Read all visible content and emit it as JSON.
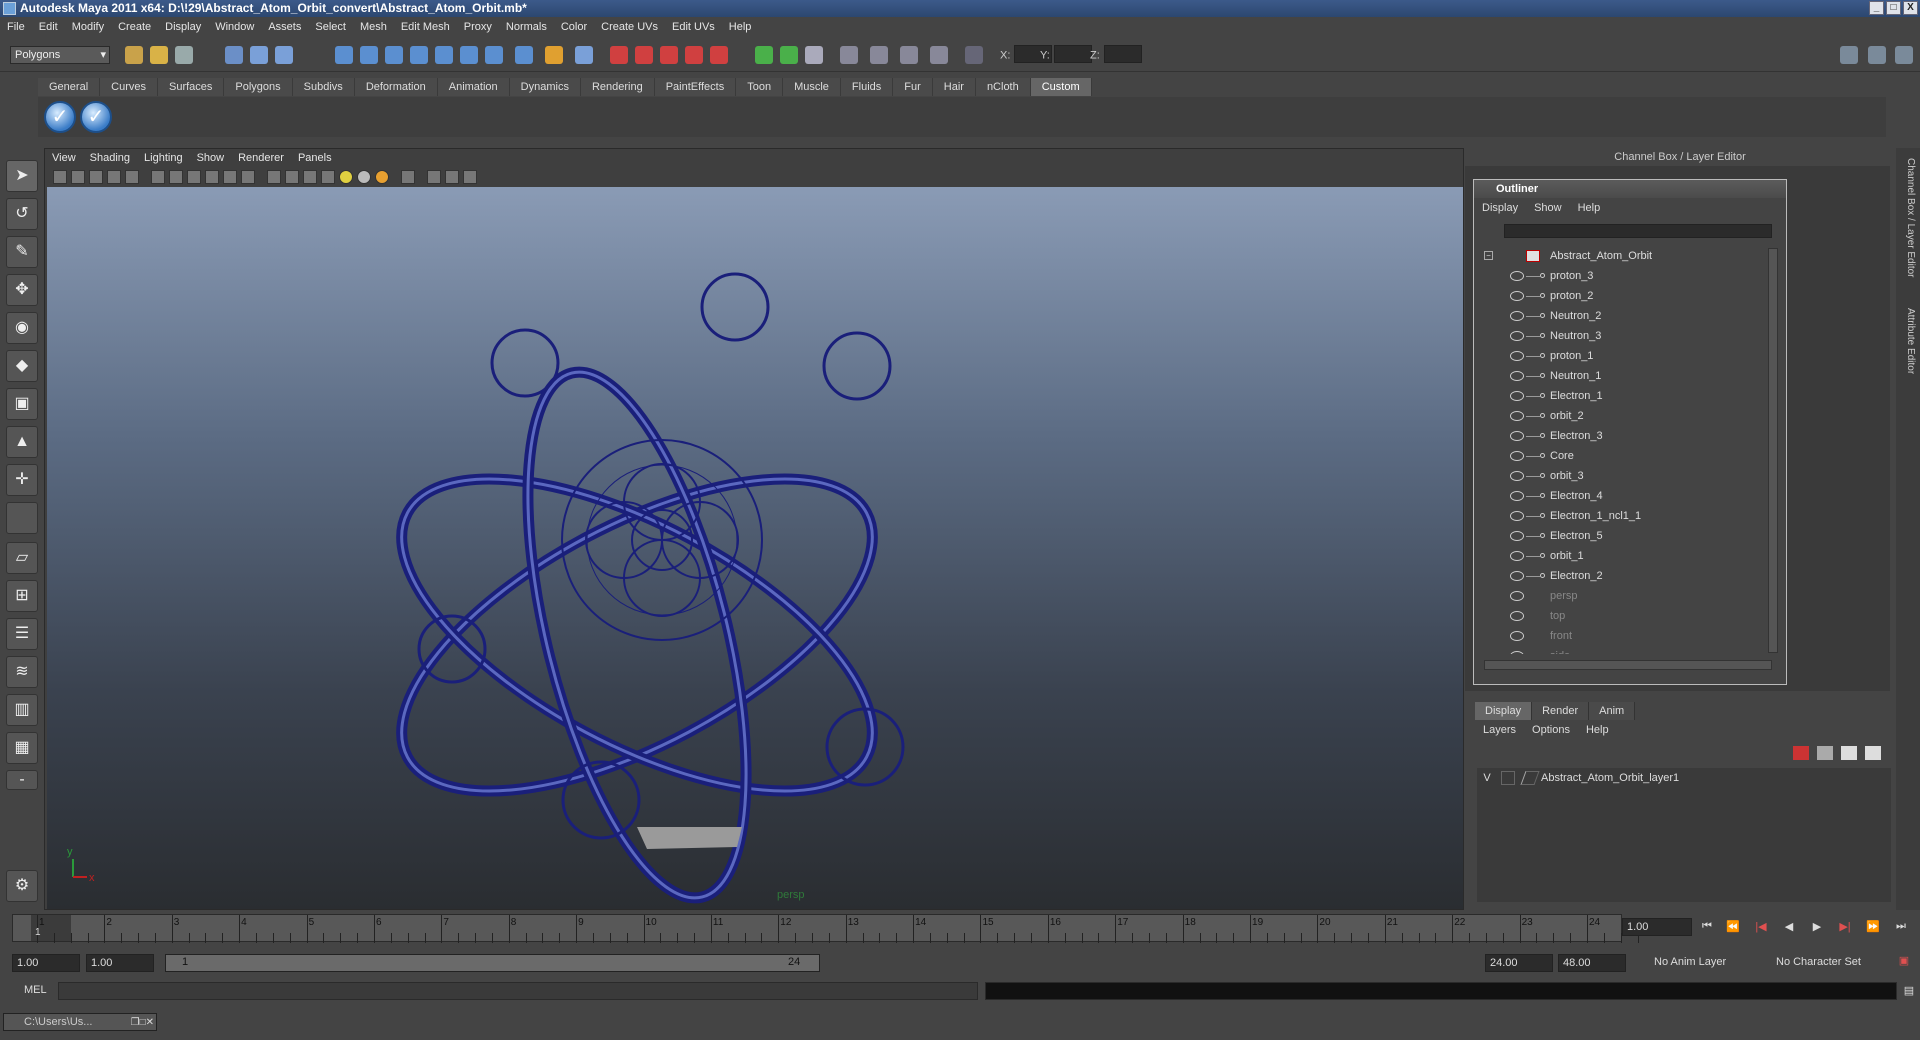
{
  "title": "Autodesk Maya 2011 x64: D:\\!29\\Abstract_Atom_Orbit_convert\\Abstract_Atom_Orbit.mb*",
  "window_buttons": [
    "_",
    "□",
    "X"
  ],
  "menubar": [
    "File",
    "Edit",
    "Modify",
    "Create",
    "Display",
    "Window",
    "Assets",
    "Select",
    "Mesh",
    "Edit Mesh",
    "Proxy",
    "Normals",
    "Color",
    "Create UVs",
    "Edit UVs",
    "Help"
  ],
  "toolbar": {
    "mode": "Polygons",
    "x_label": "X:",
    "y_label": "Y:",
    "z_label": "Z:"
  },
  "shelf_tabs": [
    "General",
    "Curves",
    "Surfaces",
    "Polygons",
    "Subdivs",
    "Deformation",
    "Animation",
    "Dynamics",
    "Rendering",
    "PaintEffects",
    "Toon",
    "Muscle",
    "Fluids",
    "Fur",
    "Hair",
    "nCloth",
    "Custom"
  ],
  "shelf_active": "Custom",
  "viewport": {
    "menu": [
      "View",
      "Shading",
      "Lighting",
      "Show",
      "Renderer",
      "Panels"
    ],
    "camera_label": "persp",
    "axis_y": "y",
    "axis_x": "x",
    "wire_color": "#1a1f7a"
  },
  "channel_box_header": "Channel Box / Layer Editor",
  "outliner": {
    "title": "Outliner",
    "menu": [
      "Display",
      "Show",
      "Help"
    ],
    "root": "Abstract_Atom_Orbit",
    "children": [
      "proton_3",
      "proton_2",
      "Neutron_2",
      "Neutron_3",
      "proton_1",
      "Neutron_1",
      "Electron_1",
      "orbit_2",
      "Electron_3",
      "Core",
      "orbit_3",
      "Electron_4",
      "Electron_1_ncl1_1",
      "Electron_5",
      "orbit_1",
      "Electron_2"
    ],
    "cameras": [
      "persp",
      "top",
      "front",
      "side"
    ]
  },
  "layer_editor": {
    "tabs": [
      "Display",
      "Render",
      "Anim"
    ],
    "menu": [
      "Layers",
      "Options",
      "Help"
    ],
    "layers": [
      {
        "v": "V",
        "name": "Abstract_Atom_Orbit_layer1"
      }
    ]
  },
  "right_tabs": [
    "Channel Box / Layer Editor",
    "Attribute Editor"
  ],
  "timeline": {
    "ticks": [
      "1",
      "2",
      "3",
      "4",
      "5",
      "6",
      "7",
      "8",
      "9",
      "10",
      "11",
      "12",
      "13",
      "14",
      "15",
      "16",
      "17",
      "18",
      "19",
      "20",
      "21",
      "22",
      "23",
      "24"
    ],
    "current_marker": "1",
    "current_frame": "1.00"
  },
  "range": {
    "start": "1.00",
    "playback_start": "1.00",
    "slider_start": "1",
    "slider_end": "24",
    "playback_end": "24.00",
    "end": "48.00",
    "anim_layer": "No Anim Layer",
    "character_set": "No Character Set"
  },
  "command_line": {
    "label": "MEL"
  },
  "taskbar": {
    "window": "C:\\Users\\Us..."
  }
}
